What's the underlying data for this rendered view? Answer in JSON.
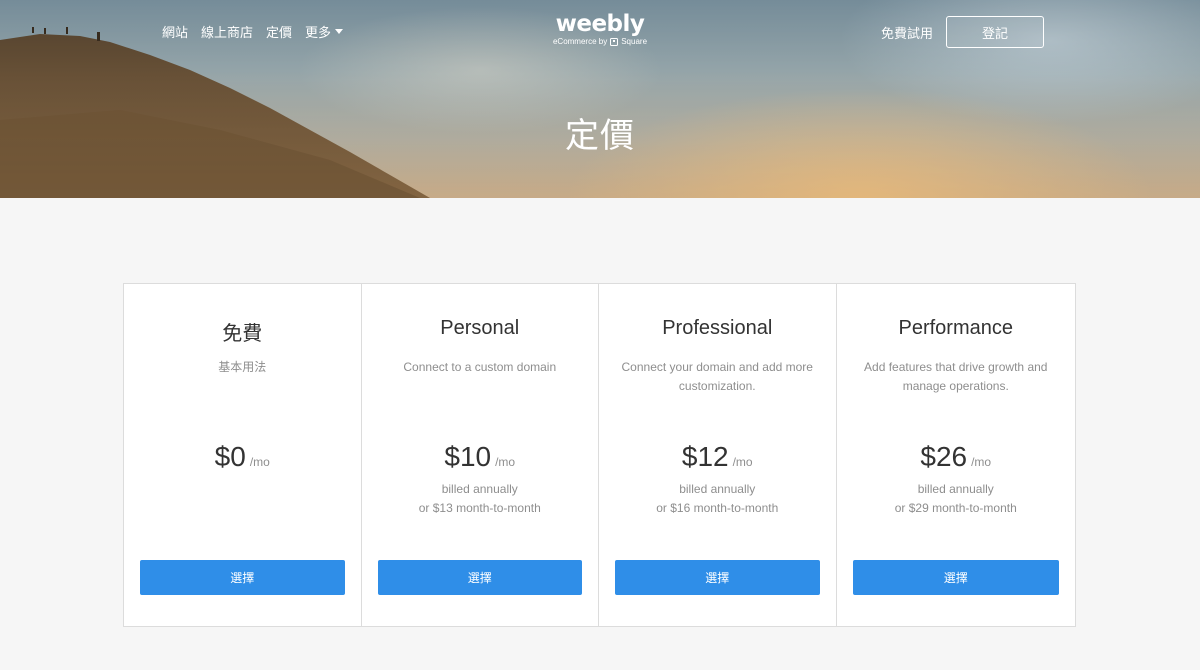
{
  "nav": {
    "items": [
      {
        "label": "網站"
      },
      {
        "label": "線上商店"
      },
      {
        "label": "定價"
      },
      {
        "label": "更多"
      }
    ],
    "trial_label": "免費試用",
    "login_label": "登記"
  },
  "brand": {
    "name": "weebly",
    "tagline_prefix": "eCommerce by",
    "tagline_brand": "Square"
  },
  "hero": {
    "title": "定價"
  },
  "plans": [
    {
      "name": "免費",
      "description": "基本用法",
      "price": "$0",
      "unit": "/mo",
      "billing_line1": "",
      "billing_line2": "",
      "button": "選擇"
    },
    {
      "name": "Personal",
      "description": "Connect to a custom domain",
      "price": "$10",
      "unit": "/mo",
      "billing_line1": "billed annually",
      "billing_line2": "or $13 month-to-month",
      "button": "選擇"
    },
    {
      "name": "Professional",
      "description": "Connect your domain and add more customization.",
      "price": "$12",
      "unit": "/mo",
      "billing_line1": "billed annually",
      "billing_line2": "or $16 month-to-month",
      "button": "選擇"
    },
    {
      "name": "Performance",
      "description": "Add features that drive growth and manage operations.",
      "price": "$26",
      "unit": "/mo",
      "billing_line1": "billed annually",
      "billing_line2": "or $29 month-to-month",
      "button": "選擇"
    }
  ],
  "colors": {
    "accent": "#2f8ee8",
    "page_bg": "#f6f6f6",
    "text_muted": "#8e8e8e"
  }
}
